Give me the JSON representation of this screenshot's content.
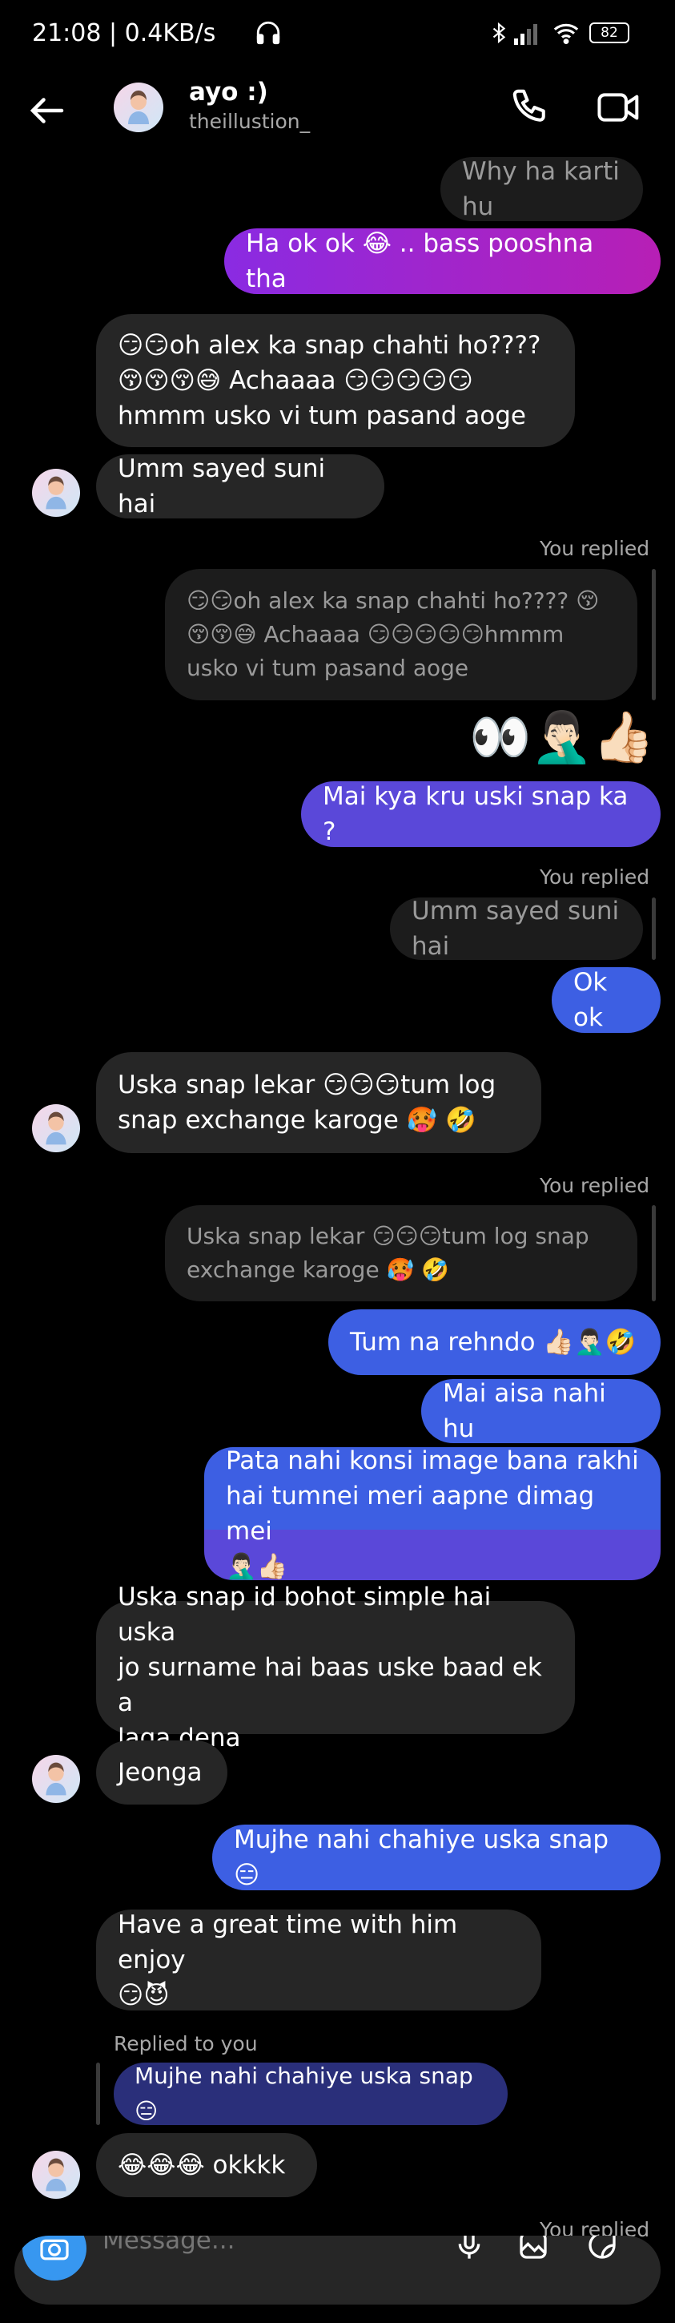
{
  "status_bar": {
    "time_speed": "21:08 | 0.4KB/s",
    "battery": "82"
  },
  "header": {
    "name": "ayo :)",
    "username": "theillustion_"
  },
  "messages": {
    "m1": "Why ha karti hu",
    "m2": "Ha ok ok 😂 .. bass pooshna tha",
    "m3": "😏😏oh alex ka snap chahti ho????\n😚😚😚😅 Achaaaa 😏😏😏😏😏\nhmmm usko vi tum pasand aoge",
    "m4": "Umm sayed suni hai",
    "m5_label": "You replied",
    "m5_quote": "😏😏oh alex ka snap chahti ho???? 😚\n😚😚😅 Achaaaa 😏😏😏😏😏hmmm\nusko vi tum pasand aoge",
    "m5_reaction": "👀🤦🏻‍♂️👍🏻",
    "m6": "Mai kya kru uski snap ka ?",
    "m7_label": "You replied",
    "m7_quote": "Umm sayed suni hai",
    "m8": "Ok ok",
    "m9": "Uska snap lekar 😏😏😏tum log\nsnap exchange karoge 🥵 🤣",
    "m10_label": "You replied",
    "m10_quote": "Uska snap lekar 😏😏😏tum log snap\nexchange karoge 🥵 🤣",
    "m11": "Tum na rehndo 👍🏻🤦🏻‍♂️🤣",
    "m12": "Mai aisa nahi hu",
    "m13": "Pata nahi konsi image bana rakhi\nhai tumnei meri aapne dimag mei\n🤦🏻‍♂️👍🏻",
    "m14": "Uska snap id bohot simple hai uska\njo surname hai baas uske baad ek a\nlaga dena",
    "m15": "Jeonga",
    "m16": "Mujhe nahi chahiye uska snap 😑",
    "m17": "Have a great time with him enjoy\n😏😈",
    "m18_label": "Replied to you",
    "m18_quote": "Mujhe nahi chahiye uska snap 😑",
    "m19": "😂😂😂 okkkk",
    "m20_label": "You replied"
  },
  "composer": {
    "placeholder": "Message..."
  },
  "colors": {
    "accent_blue": "#3d5fe3",
    "accent_purple": "#b71fb5",
    "incoming": "#262626"
  }
}
